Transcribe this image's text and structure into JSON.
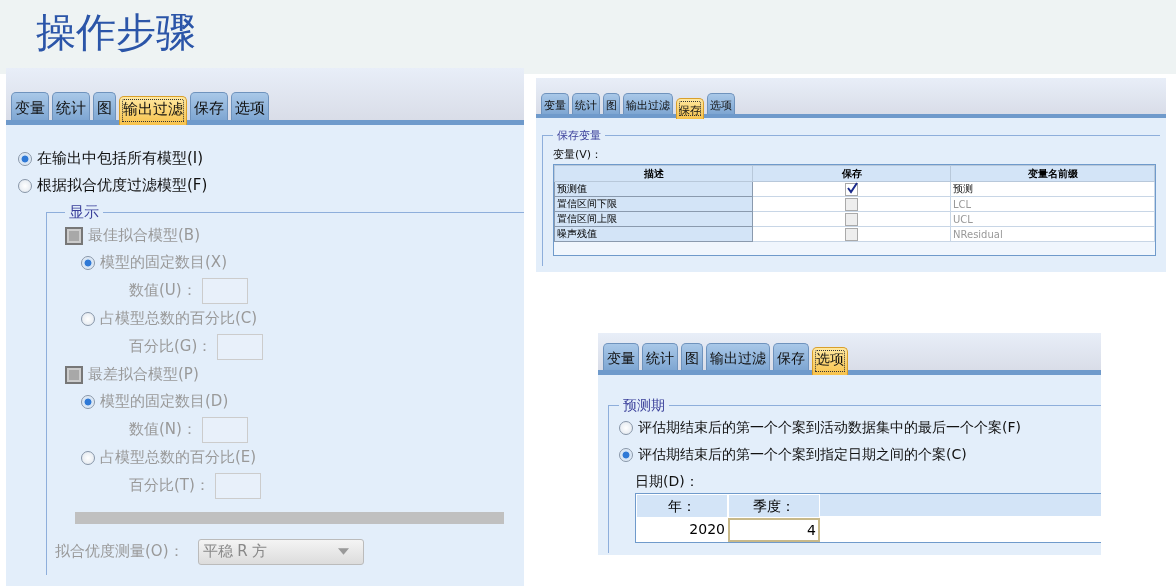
{
  "title": "操作步骤",
  "panels": [
    {
      "kind": "output_filter",
      "tabs": [
        {
          "label": "变量",
          "selected": false
        },
        {
          "label": "统计",
          "selected": false
        },
        {
          "label": "图",
          "selected": false
        },
        {
          "label": "输出过滤",
          "selected": true
        },
        {
          "label": "保存",
          "selected": false
        },
        {
          "label": "选项",
          "selected": false
        }
      ],
      "options": [
        {
          "label": "在输出中包括所有模型(I)",
          "selected": true
        },
        {
          "label": "根据拟合优度过滤模型(F)",
          "selected": false
        }
      ],
      "group": {
        "title": "显示",
        "disabled": true,
        "sections": [
          {
            "label": "最佳拟合模型(B)",
            "checked": false,
            "options": [
              {
                "label": "模型的固定数目(X)",
                "selected": true,
                "field_label": "数值(U)："
              },
              {
                "label": "占模型总数的百分比(C)",
                "selected": false,
                "field_label": "百分比(G)："
              }
            ]
          },
          {
            "label": "最差拟合模型(P)",
            "checked": false,
            "options": [
              {
                "label": "模型的固定数目(D)",
                "selected": true,
                "field_label": "数值(N)："
              },
              {
                "label": "占模型总数的百分比(E)",
                "selected": false,
                "field_label": "百分比(T)："
              }
            ]
          }
        ],
        "measure": {
          "label": "拟合优度测量(O)：",
          "value": "平稳 R 方"
        }
      }
    },
    {
      "kind": "save",
      "tabs": [
        {
          "label": "变量",
          "selected": false
        },
        {
          "label": "统计",
          "selected": false
        },
        {
          "label": "图",
          "selected": false
        },
        {
          "label": "输出过滤",
          "selected": false
        },
        {
          "label": "保存",
          "selected": true
        },
        {
          "label": "选项",
          "selected": false
        }
      ],
      "group": {
        "title": "保存变量",
        "label": "变量(V)：",
        "columns": [
          "描述",
          "保存",
          "变量名前缀"
        ],
        "rows": [
          {
            "description": "预测值",
            "save": true,
            "prefix": "预测"
          },
          {
            "description": "置信区间下限",
            "save": false,
            "prefix": "LCL"
          },
          {
            "description": "置信区间上限",
            "save": false,
            "prefix": "UCL"
          },
          {
            "description": "噪声残值",
            "save": false,
            "prefix": "NResidual"
          }
        ]
      }
    },
    {
      "kind": "options",
      "tabs": [
        {
          "label": "变量",
          "selected": false
        },
        {
          "label": "统计",
          "selected": false
        },
        {
          "label": "图",
          "selected": false
        },
        {
          "label": "输出过滤",
          "selected": false
        },
        {
          "label": "保存",
          "selected": false
        },
        {
          "label": "选项",
          "selected": true
        }
      ],
      "group": {
        "title": "预测期",
        "options": [
          {
            "label": "评估期结束后的第一个个案到活动数据集中的最后一个个案(F)",
            "selected": false
          },
          {
            "label": "评估期结束后的第一个个案到指定日期之间的个案(C)",
            "selected": true
          }
        ],
        "date_label": "日期(D)：",
        "columns": [
          "年：",
          "季度："
        ],
        "cells": [
          {
            "text": "2020",
            "selected": false
          },
          {
            "text": "4",
            "selected": true
          }
        ]
      }
    }
  ]
}
